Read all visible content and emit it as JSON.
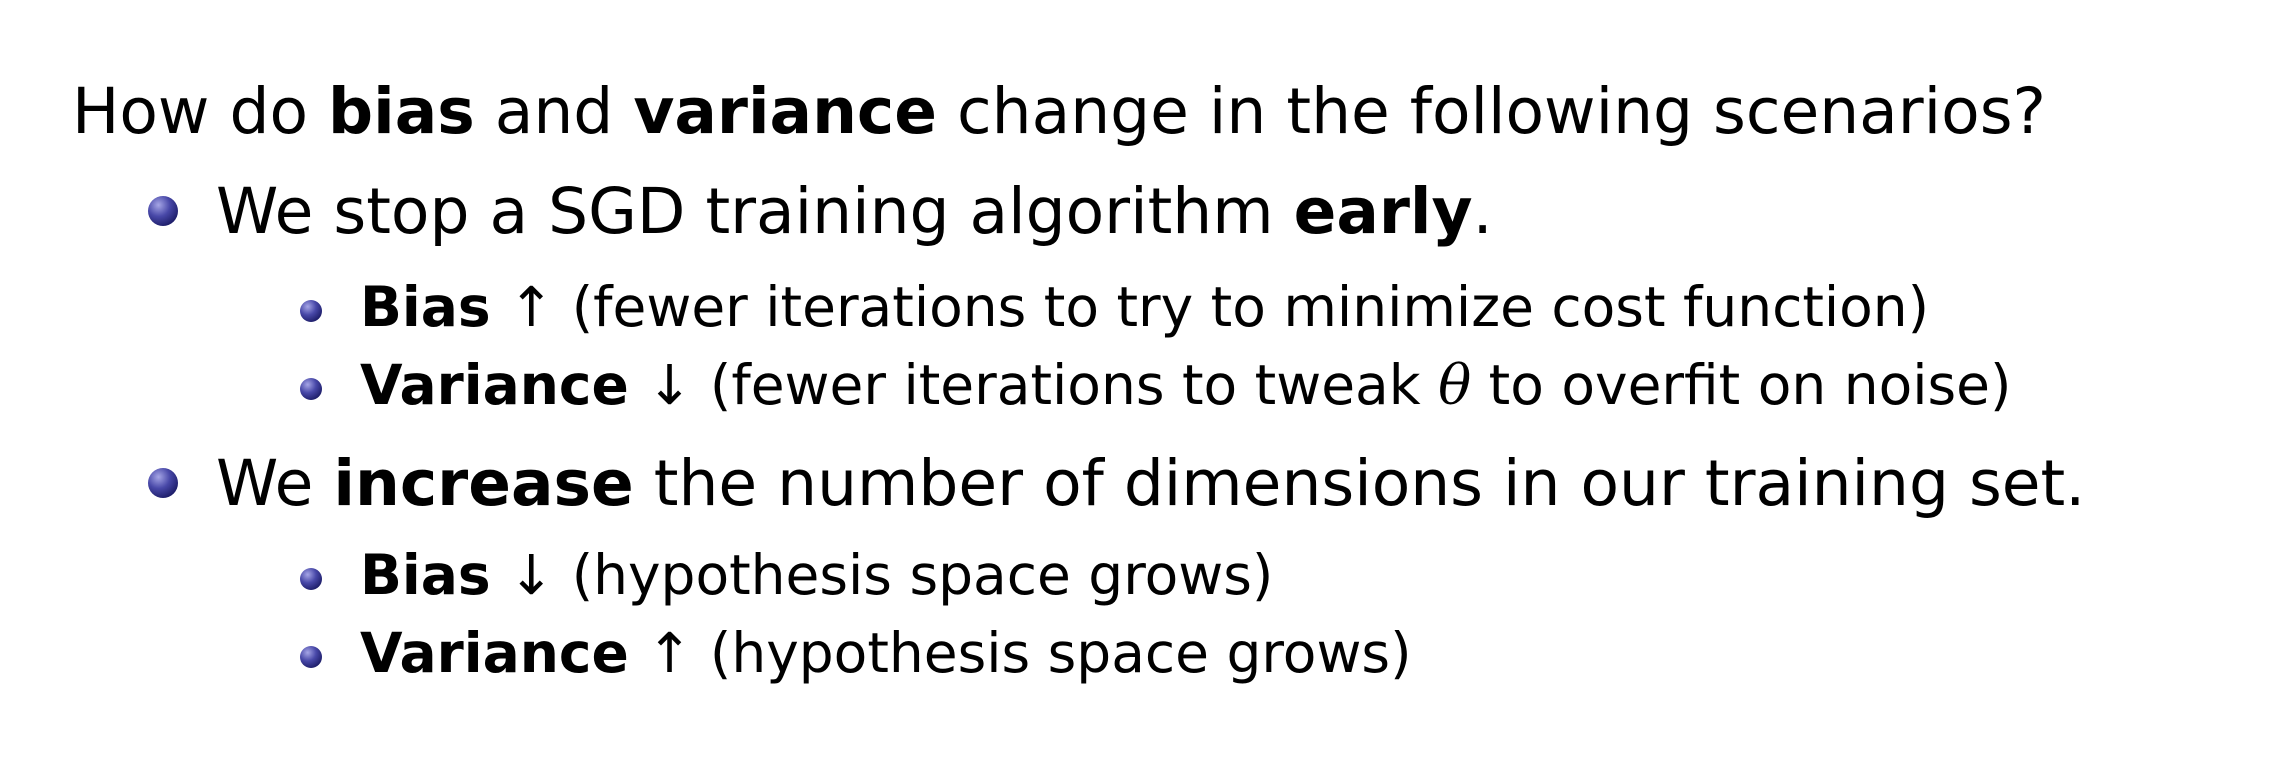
{
  "question": {
    "prefix": "How do ",
    "bias": "bias",
    "mid": " and ",
    "variance": "variance",
    "suffix": " change in the following scenarios?"
  },
  "scenarios": [
    {
      "prefix": "We stop a SGD training algorithm ",
      "bold": "early",
      "suffix": ".",
      "effects": [
        {
          "term": "Bias",
          "arrow": "↑",
          "explanation": "(fewer iterations to try to minimize cost function)"
        },
        {
          "term": "Variance",
          "arrow": "↓",
          "explanation_before": "(fewer iterations to tweak ",
          "symbol": "θ",
          "explanation_after": " to overfit on noise)"
        }
      ]
    },
    {
      "prefix": "We ",
      "bold": "increase",
      "suffix": " the number of dimensions in our training set.",
      "effects": [
        {
          "term": "Bias",
          "arrow": "↓",
          "explanation": "(hypothesis space grows)"
        },
        {
          "term": "Variance",
          "arrow": "↑",
          "explanation": "(hypothesis space grows)"
        }
      ]
    }
  ],
  "colors": {
    "text": "#000000",
    "bullet": "#2b2b7a"
  }
}
